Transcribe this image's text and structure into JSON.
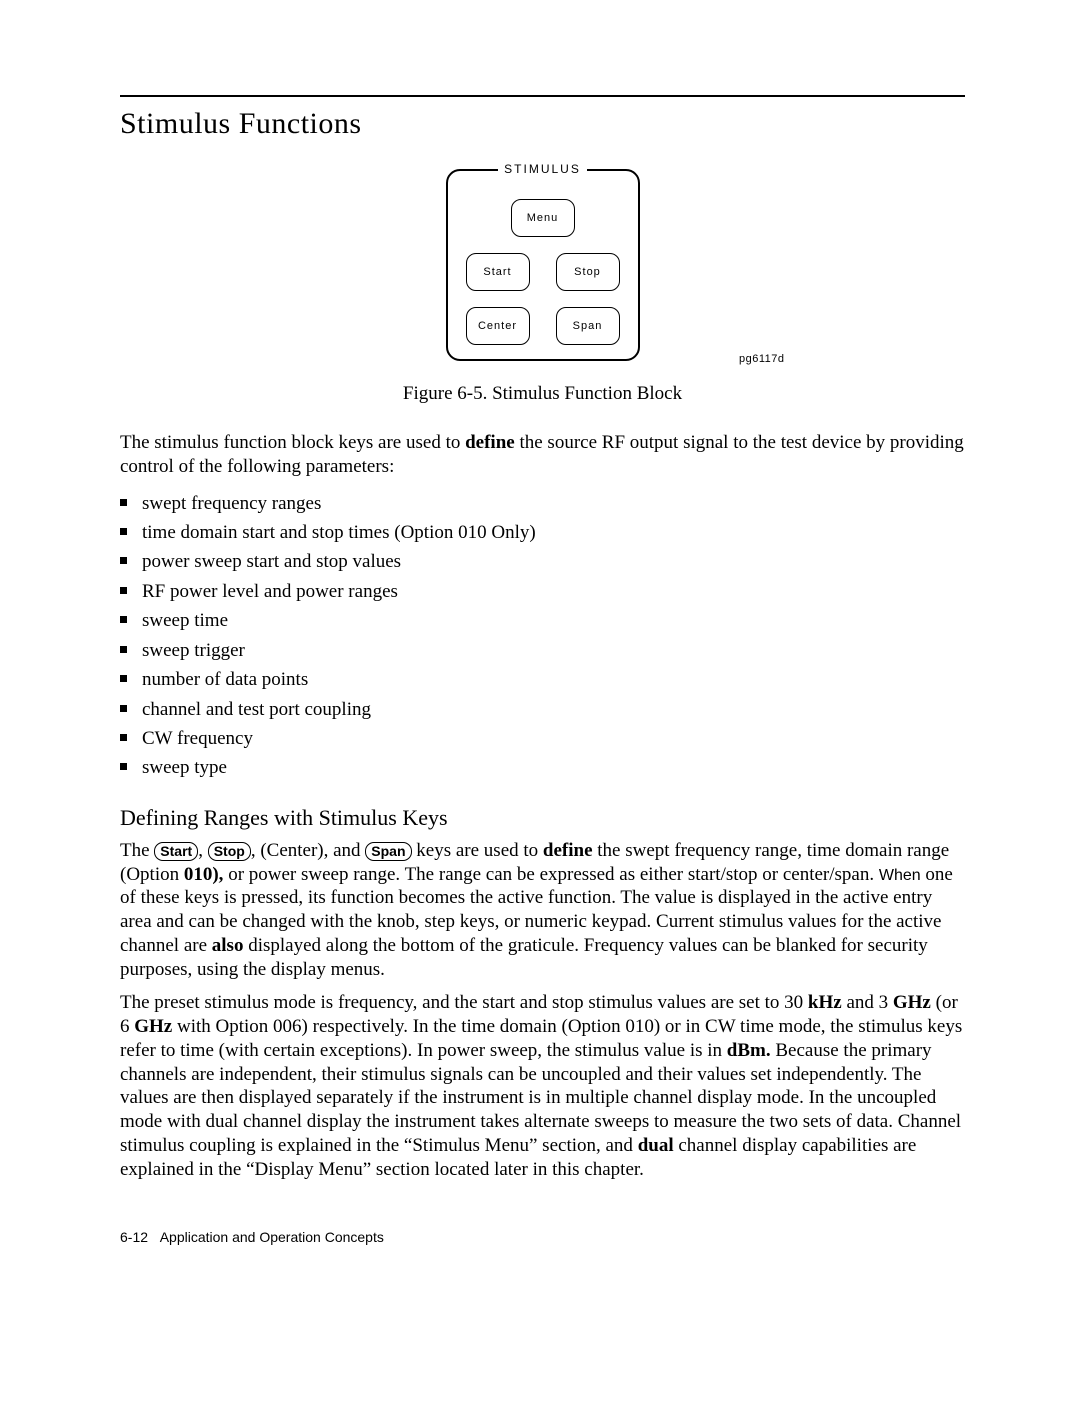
{
  "title": "Stimulus Functions",
  "figure": {
    "block_label": "STIMULUS",
    "keys": {
      "menu": "Menu",
      "start": "Start",
      "stop": "Stop",
      "center": "Center",
      "span": "Span"
    },
    "id": "pg6117d",
    "caption": "Figure 6-5. Stimulus Function Block"
  },
  "intro_p1_a": "The stimulus function block keys are used to ",
  "intro_p1_b": "define",
  "intro_p1_c": " the source RF output signal to the test device by providing control of the following parameters:",
  "bullets": [
    "swept frequency ranges",
    "time domain start and stop times (Option 010 Only)",
    "power sweep start and stop values",
    "RF power level and power ranges",
    "sweep time",
    "sweep trigger",
    "number of data points",
    "channel and test port coupling",
    "CW frequency",
    "sweep type"
  ],
  "subsection_title": "Defining Ranges with Stimulus Keys",
  "para2": {
    "a": "The ",
    "k1": "Start",
    "b": ", ",
    "k2": "Stop",
    "c": ", (Center), and ",
    "k3": "Span",
    "d": " keys are used to ",
    "bold1": "define",
    "e": " the swept frequency range, time domain range (Option ",
    "bold2": "010),",
    "f": " or power sweep range. The range can be expressed as either start/stop or center/span. ",
    "sans": "When",
    "g": " one of these keys is pressed, its function becomes the active function. The value is displayed in the active entry area and can be changed with the knob, step keys, or numeric keypad. Current stimulus values for the active channel are ",
    "bold3": "also",
    "h": " displayed along the bottom of the graticule. Frequency values can be blanked for security purposes, using the display menus."
  },
  "para3": {
    "a": "The preset stimulus mode is frequency, and the start and stop stimulus values are set to 30 ",
    "bold1": "kHz",
    "b": " and 3 ",
    "bold2": "GHz",
    "c": " (or 6 ",
    "bold3": "GHz",
    "d": " with Option 006) respectively. In the time domain (Option 010) or in CW time mode, the stimulus keys refer to time (with certain exceptions). In power sweep, the stimulus value is in ",
    "bold4": "dBm.",
    "e": " Because the primary channels are independent, their stimulus signals can be uncoupled and their values set independently. The values are then displayed separately if the instrument is in multiple channel display mode. In the uncoupled mode with dual channel display the instrument takes alternate sweeps to measure the two sets of data. Channel stimulus coupling is explained in the “Stimulus Menu” section, and ",
    "bold5": "dual",
    "f": " channel display capabilities are explained in the “Display Menu” section located later in this chapter."
  },
  "footer": {
    "page": "6-12",
    "label": "Application and Operation Concepts"
  }
}
